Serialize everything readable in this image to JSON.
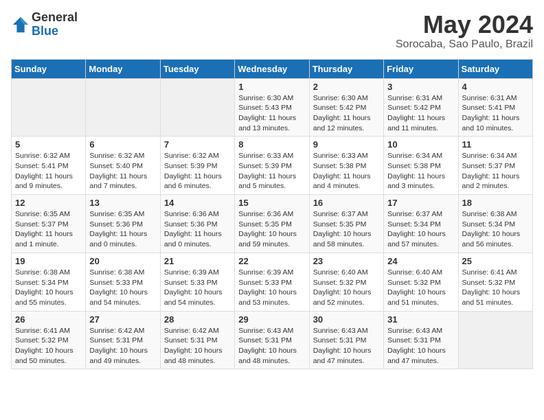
{
  "logo": {
    "general": "General",
    "blue": "Blue"
  },
  "title": {
    "month_year": "May 2024",
    "location": "Sorocaba, Sao Paulo, Brazil"
  },
  "weekdays": [
    "Sunday",
    "Monday",
    "Tuesday",
    "Wednesday",
    "Thursday",
    "Friday",
    "Saturday"
  ],
  "weeks": [
    [
      {
        "num": "",
        "info": ""
      },
      {
        "num": "",
        "info": ""
      },
      {
        "num": "",
        "info": ""
      },
      {
        "num": "1",
        "info": "Sunrise: 6:30 AM\nSunset: 5:43 PM\nDaylight: 11 hours\nand 13 minutes."
      },
      {
        "num": "2",
        "info": "Sunrise: 6:30 AM\nSunset: 5:42 PM\nDaylight: 11 hours\nand 12 minutes."
      },
      {
        "num": "3",
        "info": "Sunrise: 6:31 AM\nSunset: 5:42 PM\nDaylight: 11 hours\nand 11 minutes."
      },
      {
        "num": "4",
        "info": "Sunrise: 6:31 AM\nSunset: 5:41 PM\nDaylight: 11 hours\nand 10 minutes."
      }
    ],
    [
      {
        "num": "5",
        "info": "Sunrise: 6:32 AM\nSunset: 5:41 PM\nDaylight: 11 hours\nand 9 minutes."
      },
      {
        "num": "6",
        "info": "Sunrise: 6:32 AM\nSunset: 5:40 PM\nDaylight: 11 hours\nand 7 minutes."
      },
      {
        "num": "7",
        "info": "Sunrise: 6:32 AM\nSunset: 5:39 PM\nDaylight: 11 hours\nand 6 minutes."
      },
      {
        "num": "8",
        "info": "Sunrise: 6:33 AM\nSunset: 5:39 PM\nDaylight: 11 hours\nand 5 minutes."
      },
      {
        "num": "9",
        "info": "Sunrise: 6:33 AM\nSunset: 5:38 PM\nDaylight: 11 hours\nand 4 minutes."
      },
      {
        "num": "10",
        "info": "Sunrise: 6:34 AM\nSunset: 5:38 PM\nDaylight: 11 hours\nand 3 minutes."
      },
      {
        "num": "11",
        "info": "Sunrise: 6:34 AM\nSunset: 5:37 PM\nDaylight: 11 hours\nand 2 minutes."
      }
    ],
    [
      {
        "num": "12",
        "info": "Sunrise: 6:35 AM\nSunset: 5:37 PM\nDaylight: 11 hours\nand 1 minute."
      },
      {
        "num": "13",
        "info": "Sunrise: 6:35 AM\nSunset: 5:36 PM\nDaylight: 11 hours\nand 0 minutes."
      },
      {
        "num": "14",
        "info": "Sunrise: 6:36 AM\nSunset: 5:36 PM\nDaylight: 11 hours\nand 0 minutes."
      },
      {
        "num": "15",
        "info": "Sunrise: 6:36 AM\nSunset: 5:35 PM\nDaylight: 10 hours\nand 59 minutes."
      },
      {
        "num": "16",
        "info": "Sunrise: 6:37 AM\nSunset: 5:35 PM\nDaylight: 10 hours\nand 58 minutes."
      },
      {
        "num": "17",
        "info": "Sunrise: 6:37 AM\nSunset: 5:34 PM\nDaylight: 10 hours\nand 57 minutes."
      },
      {
        "num": "18",
        "info": "Sunrise: 6:38 AM\nSunset: 5:34 PM\nDaylight: 10 hours\nand 56 minutes."
      }
    ],
    [
      {
        "num": "19",
        "info": "Sunrise: 6:38 AM\nSunset: 5:34 PM\nDaylight: 10 hours\nand 55 minutes."
      },
      {
        "num": "20",
        "info": "Sunrise: 6:38 AM\nSunset: 5:33 PM\nDaylight: 10 hours\nand 54 minutes."
      },
      {
        "num": "21",
        "info": "Sunrise: 6:39 AM\nSunset: 5:33 PM\nDaylight: 10 hours\nand 54 minutes."
      },
      {
        "num": "22",
        "info": "Sunrise: 6:39 AM\nSunset: 5:33 PM\nDaylight: 10 hours\nand 53 minutes."
      },
      {
        "num": "23",
        "info": "Sunrise: 6:40 AM\nSunset: 5:32 PM\nDaylight: 10 hours\nand 52 minutes."
      },
      {
        "num": "24",
        "info": "Sunrise: 6:40 AM\nSunset: 5:32 PM\nDaylight: 10 hours\nand 51 minutes."
      },
      {
        "num": "25",
        "info": "Sunrise: 6:41 AM\nSunset: 5:32 PM\nDaylight: 10 hours\nand 51 minutes."
      }
    ],
    [
      {
        "num": "26",
        "info": "Sunrise: 6:41 AM\nSunset: 5:32 PM\nDaylight: 10 hours\nand 50 minutes."
      },
      {
        "num": "27",
        "info": "Sunrise: 6:42 AM\nSunset: 5:31 PM\nDaylight: 10 hours\nand 49 minutes."
      },
      {
        "num": "28",
        "info": "Sunrise: 6:42 AM\nSunset: 5:31 PM\nDaylight: 10 hours\nand 48 minutes."
      },
      {
        "num": "29",
        "info": "Sunrise: 6:43 AM\nSunset: 5:31 PM\nDaylight: 10 hours\nand 48 minutes."
      },
      {
        "num": "30",
        "info": "Sunrise: 6:43 AM\nSunset: 5:31 PM\nDaylight: 10 hours\nand 47 minutes."
      },
      {
        "num": "31",
        "info": "Sunrise: 6:43 AM\nSunset: 5:31 PM\nDaylight: 10 hours\nand 47 minutes."
      },
      {
        "num": "",
        "info": ""
      }
    ]
  ]
}
